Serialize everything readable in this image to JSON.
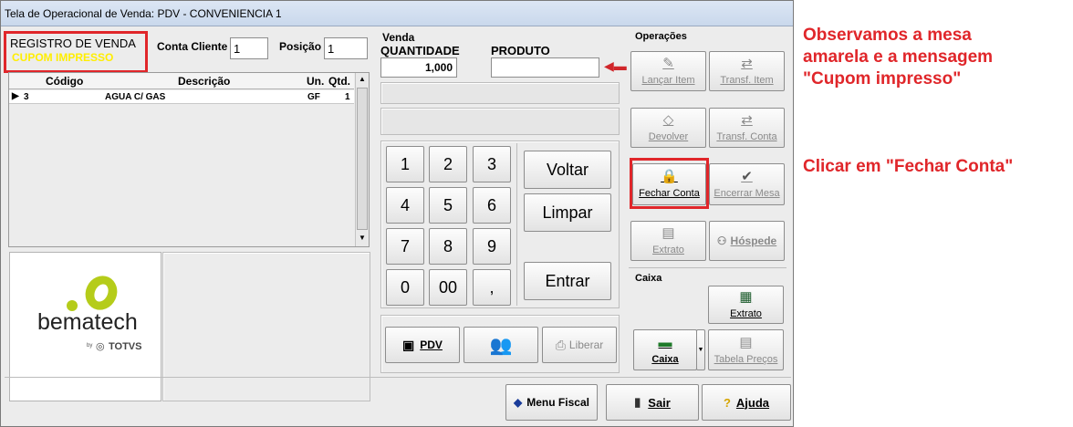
{
  "window": {
    "title": "Tela de Operacional de Venda: PDV - CONVENIENCIA 1"
  },
  "status": {
    "title": "REGISTRO DE VENDA",
    "subtitle": "CUPOM IMPRESSO",
    "subtitle_color": "#ffee00"
  },
  "conta_cliente": {
    "label": "Conta Cliente",
    "value": "1"
  },
  "posicao": {
    "label": "Posição",
    "value": "1"
  },
  "table": {
    "headers": [
      "Código",
      "Descrição",
      "Un.",
      "Qtd."
    ],
    "rows": [
      {
        "codigo": "3",
        "descricao": "AGUA C/ GAS",
        "un": "GF",
        "qtd": "1"
      }
    ]
  },
  "logo": {
    "brand": "bematech",
    "sub": "TOTVS",
    "sub_prefix": "by"
  },
  "venda": {
    "group": "Venda",
    "quantidade_label": "QUANTIDADE",
    "quantidade_value": "1,000",
    "produto_label": "PRODUTO",
    "produto_value": ""
  },
  "keypad": {
    "keys": [
      "1",
      "2",
      "3",
      "4",
      "5",
      "6",
      "7",
      "8",
      "9",
      "0",
      "00",
      ","
    ],
    "voltar": "Voltar",
    "limpar": "Limpar",
    "entrar": "Entrar"
  },
  "bottom_buttons": {
    "pdv": "PDV",
    "liberar": "Liberar"
  },
  "operacoes": {
    "group": "Operações",
    "lancar_item": "Lançar Item",
    "transf_item": "Transf. Item",
    "devolver": "Devolver",
    "transf_conta": "Transf. Conta",
    "fechar_conta": "Fechar Conta",
    "encerrar_mesa": "Encerrar Mesa",
    "extrato": "Extrato",
    "hospede": "Hóspede"
  },
  "caixa": {
    "group": "Caixa",
    "extrato": "Extrato",
    "caixa": "Caixa",
    "tabela_precos": "Tabela Preços"
  },
  "footer": {
    "menu_fiscal": "Menu Fiscal",
    "sair": "Sair",
    "ajuda": "Ajuda"
  },
  "annotations": {
    "line1": "Observamos a mesa",
    "line2": "amarela e a mensagem",
    "line3": "\"Cupom impresso\"",
    "line4": "Clicar em \"Fechar Conta\""
  },
  "colors": {
    "highlight": "#e0262a",
    "logo_green": "#b5cc1a"
  }
}
